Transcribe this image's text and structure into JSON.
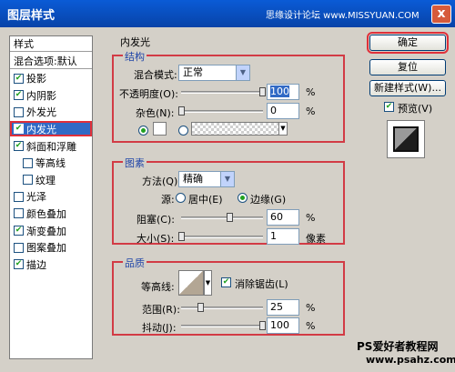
{
  "window": {
    "title": "图层样式",
    "watermark": "思缘设计论坛 www.MISSYUAN.COM",
    "close": "x"
  },
  "sidebar": {
    "header": "样式",
    "items": [
      {
        "label": "混合选项:默认",
        "checkbox": false,
        "checked": false
      },
      {
        "label": "投影",
        "checkbox": true,
        "checked": true
      },
      {
        "label": "内阴影",
        "checkbox": true,
        "checked": true
      },
      {
        "label": "外发光",
        "checkbox": true,
        "checked": false
      },
      {
        "label": "内发光",
        "checkbox": true,
        "checked": true,
        "selected": true
      },
      {
        "label": "斜面和浮雕",
        "checkbox": true,
        "checked": true
      },
      {
        "label": "等高线",
        "checkbox": true,
        "checked": false,
        "sub": true
      },
      {
        "label": "纹理",
        "checkbox": true,
        "checked": false,
        "sub": true
      },
      {
        "label": "光泽",
        "checkbox": true,
        "checked": false
      },
      {
        "label": "颜色叠加",
        "checkbox": true,
        "checked": false
      },
      {
        "label": "渐变叠加",
        "checkbox": true,
        "checked": true
      },
      {
        "label": "图案叠加",
        "checkbox": true,
        "checked": false
      },
      {
        "label": "描边",
        "checkbox": true,
        "checked": true
      }
    ]
  },
  "panel": {
    "title": "内发光",
    "structure": {
      "legend": "结构",
      "blend_mode_label": "混合模式:",
      "blend_mode_value": "正常",
      "opacity_label": "不透明度(O):",
      "opacity_value": "100",
      "opacity_unit": "%",
      "noise_label": "杂色(N):",
      "noise_value": "0",
      "noise_unit": "%"
    },
    "elements": {
      "legend": "图素",
      "method_label": "方法(Q):",
      "method_value": "精确",
      "source_label": "源:",
      "source_center": "居中(E)",
      "source_edge": "边缘(G)",
      "choke_label": "阻塞(C):",
      "choke_value": "60",
      "choke_unit": "%",
      "size_label": "大小(S):",
      "size_value": "1",
      "size_unit": "像素"
    },
    "quality": {
      "legend": "品质",
      "contour_label": "等高线:",
      "antialias_label": "消除锯齿(L)",
      "range_label": "范围(R):",
      "range_value": "25",
      "range_unit": "%",
      "jitter_label": "抖动(J):",
      "jitter_value": "100",
      "jitter_unit": "%"
    }
  },
  "buttons": {
    "ok": "确定",
    "reset": "复位",
    "new_style": "新建样式(W)...",
    "preview": "预览(V)"
  },
  "footer": {
    "line1": "PS爱好者教程网",
    "line2": "www.psahz.com"
  }
}
